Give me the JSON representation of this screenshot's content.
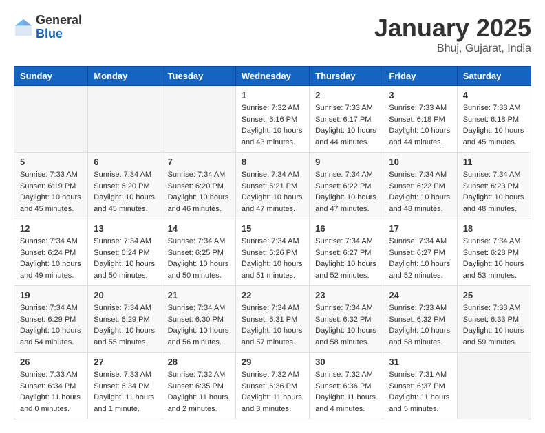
{
  "header": {
    "logo_general": "General",
    "logo_blue": "Blue",
    "month_title": "January 2025",
    "location": "Bhuj, Gujarat, India"
  },
  "weekdays": [
    "Sunday",
    "Monday",
    "Tuesday",
    "Wednesday",
    "Thursday",
    "Friday",
    "Saturday"
  ],
  "weeks": [
    [
      {
        "day": "",
        "sunrise": "",
        "sunset": "",
        "daylight": ""
      },
      {
        "day": "",
        "sunrise": "",
        "sunset": "",
        "daylight": ""
      },
      {
        "day": "",
        "sunrise": "",
        "sunset": "",
        "daylight": ""
      },
      {
        "day": "1",
        "sunrise": "Sunrise: 7:32 AM",
        "sunset": "Sunset: 6:16 PM",
        "daylight": "Daylight: 10 hours and 43 minutes."
      },
      {
        "day": "2",
        "sunrise": "Sunrise: 7:33 AM",
        "sunset": "Sunset: 6:17 PM",
        "daylight": "Daylight: 10 hours and 44 minutes."
      },
      {
        "day": "3",
        "sunrise": "Sunrise: 7:33 AM",
        "sunset": "Sunset: 6:18 PM",
        "daylight": "Daylight: 10 hours and 44 minutes."
      },
      {
        "day": "4",
        "sunrise": "Sunrise: 7:33 AM",
        "sunset": "Sunset: 6:18 PM",
        "daylight": "Daylight: 10 hours and 45 minutes."
      }
    ],
    [
      {
        "day": "5",
        "sunrise": "Sunrise: 7:33 AM",
        "sunset": "Sunset: 6:19 PM",
        "daylight": "Daylight: 10 hours and 45 minutes."
      },
      {
        "day": "6",
        "sunrise": "Sunrise: 7:34 AM",
        "sunset": "Sunset: 6:20 PM",
        "daylight": "Daylight: 10 hours and 45 minutes."
      },
      {
        "day": "7",
        "sunrise": "Sunrise: 7:34 AM",
        "sunset": "Sunset: 6:20 PM",
        "daylight": "Daylight: 10 hours and 46 minutes."
      },
      {
        "day": "8",
        "sunrise": "Sunrise: 7:34 AM",
        "sunset": "Sunset: 6:21 PM",
        "daylight": "Daylight: 10 hours and 47 minutes."
      },
      {
        "day": "9",
        "sunrise": "Sunrise: 7:34 AM",
        "sunset": "Sunset: 6:22 PM",
        "daylight": "Daylight: 10 hours and 47 minutes."
      },
      {
        "day": "10",
        "sunrise": "Sunrise: 7:34 AM",
        "sunset": "Sunset: 6:22 PM",
        "daylight": "Daylight: 10 hours and 48 minutes."
      },
      {
        "day": "11",
        "sunrise": "Sunrise: 7:34 AM",
        "sunset": "Sunset: 6:23 PM",
        "daylight": "Daylight: 10 hours and 48 minutes."
      }
    ],
    [
      {
        "day": "12",
        "sunrise": "Sunrise: 7:34 AM",
        "sunset": "Sunset: 6:24 PM",
        "daylight": "Daylight: 10 hours and 49 minutes."
      },
      {
        "day": "13",
        "sunrise": "Sunrise: 7:34 AM",
        "sunset": "Sunset: 6:24 PM",
        "daylight": "Daylight: 10 hours and 50 minutes."
      },
      {
        "day": "14",
        "sunrise": "Sunrise: 7:34 AM",
        "sunset": "Sunset: 6:25 PM",
        "daylight": "Daylight: 10 hours and 50 minutes."
      },
      {
        "day": "15",
        "sunrise": "Sunrise: 7:34 AM",
        "sunset": "Sunset: 6:26 PM",
        "daylight": "Daylight: 10 hours and 51 minutes."
      },
      {
        "day": "16",
        "sunrise": "Sunrise: 7:34 AM",
        "sunset": "Sunset: 6:27 PM",
        "daylight": "Daylight: 10 hours and 52 minutes."
      },
      {
        "day": "17",
        "sunrise": "Sunrise: 7:34 AM",
        "sunset": "Sunset: 6:27 PM",
        "daylight": "Daylight: 10 hours and 52 minutes."
      },
      {
        "day": "18",
        "sunrise": "Sunrise: 7:34 AM",
        "sunset": "Sunset: 6:28 PM",
        "daylight": "Daylight: 10 hours and 53 minutes."
      }
    ],
    [
      {
        "day": "19",
        "sunrise": "Sunrise: 7:34 AM",
        "sunset": "Sunset: 6:29 PM",
        "daylight": "Daylight: 10 hours and 54 minutes."
      },
      {
        "day": "20",
        "sunrise": "Sunrise: 7:34 AM",
        "sunset": "Sunset: 6:29 PM",
        "daylight": "Daylight: 10 hours and 55 minutes."
      },
      {
        "day": "21",
        "sunrise": "Sunrise: 7:34 AM",
        "sunset": "Sunset: 6:30 PM",
        "daylight": "Daylight: 10 hours and 56 minutes."
      },
      {
        "day": "22",
        "sunrise": "Sunrise: 7:34 AM",
        "sunset": "Sunset: 6:31 PM",
        "daylight": "Daylight: 10 hours and 57 minutes."
      },
      {
        "day": "23",
        "sunrise": "Sunrise: 7:34 AM",
        "sunset": "Sunset: 6:32 PM",
        "daylight": "Daylight: 10 hours and 58 minutes."
      },
      {
        "day": "24",
        "sunrise": "Sunrise: 7:33 AM",
        "sunset": "Sunset: 6:32 PM",
        "daylight": "Daylight: 10 hours and 58 minutes."
      },
      {
        "day": "25",
        "sunrise": "Sunrise: 7:33 AM",
        "sunset": "Sunset: 6:33 PM",
        "daylight": "Daylight: 10 hours and 59 minutes."
      }
    ],
    [
      {
        "day": "26",
        "sunrise": "Sunrise: 7:33 AM",
        "sunset": "Sunset: 6:34 PM",
        "daylight": "Daylight: 11 hours and 0 minutes."
      },
      {
        "day": "27",
        "sunrise": "Sunrise: 7:33 AM",
        "sunset": "Sunset: 6:34 PM",
        "daylight": "Daylight: 11 hours and 1 minute."
      },
      {
        "day": "28",
        "sunrise": "Sunrise: 7:32 AM",
        "sunset": "Sunset: 6:35 PM",
        "daylight": "Daylight: 11 hours and 2 minutes."
      },
      {
        "day": "29",
        "sunrise": "Sunrise: 7:32 AM",
        "sunset": "Sunset: 6:36 PM",
        "daylight": "Daylight: 11 hours and 3 minutes."
      },
      {
        "day": "30",
        "sunrise": "Sunrise: 7:32 AM",
        "sunset": "Sunset: 6:36 PM",
        "daylight": "Daylight: 11 hours and 4 minutes."
      },
      {
        "day": "31",
        "sunrise": "Sunrise: 7:31 AM",
        "sunset": "Sunset: 6:37 PM",
        "daylight": "Daylight: 11 hours and 5 minutes."
      },
      {
        "day": "",
        "sunrise": "",
        "sunset": "",
        "daylight": ""
      }
    ]
  ]
}
